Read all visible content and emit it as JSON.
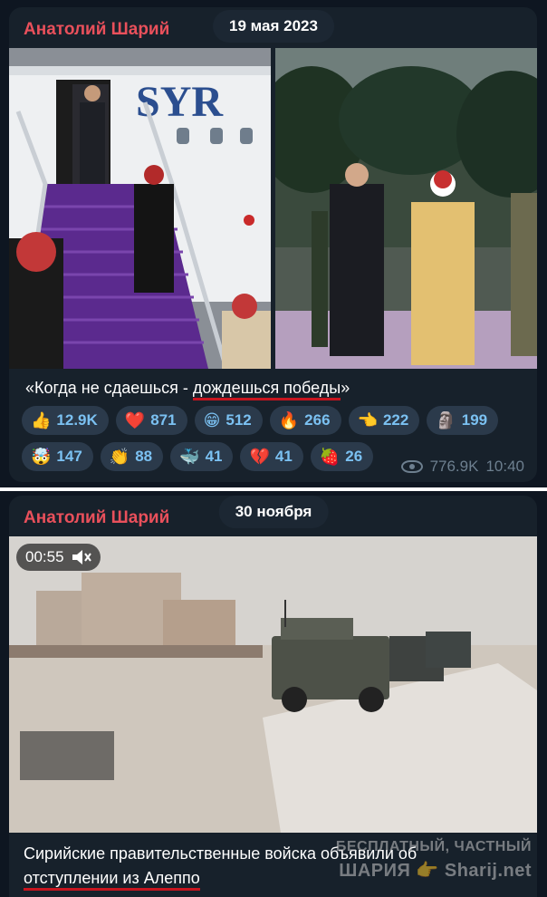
{
  "post1": {
    "author": "Анатолий Шарий",
    "date": "19 мая 2023",
    "airplane_text": "SYR",
    "caption_plain": "«Когда не сдаешься - ",
    "caption_underlined": "дождешься победы",
    "caption_end": "»",
    "reactions": [
      {
        "emoji": "👍",
        "count": "12.9K"
      },
      {
        "emoji": "❤️",
        "count": "871"
      },
      {
        "emoji": "😁",
        "count": "512"
      },
      {
        "emoji": "🔥",
        "count": "266"
      },
      {
        "emoji": "👈",
        "count": "222"
      },
      {
        "emoji": "🗿",
        "count": "199"
      },
      {
        "emoji": "🤯",
        "count": "147"
      },
      {
        "emoji": "👏",
        "count": "88"
      },
      {
        "emoji": "🐳",
        "count": "41"
      },
      {
        "emoji": "💔",
        "count": "41"
      },
      {
        "emoji": "🍓",
        "count": "26"
      }
    ],
    "views": "776.9K",
    "time": "10:40"
  },
  "post2": {
    "author": "Анатолий Шарий",
    "date": "30 ноября",
    "video_duration": "00:55",
    "caption_line1": "Сирийские правительственные войска объявили об",
    "caption_underlined": "отступлении из Алеппо",
    "watermark_line1": "БЕСПЛАТНЫЙ, ЧАСТНЫЙ",
    "watermark_line2": "ШАРИЯ 👉 Sharij.net"
  },
  "colors": {
    "background": "#0e1621",
    "bubble": "#17212b",
    "author": "#e9505b",
    "reaction_bg": "#2b3a4b",
    "reaction_text": "#7bc1f2",
    "meta": "#6d7f8f",
    "underline": "#c8151f"
  }
}
